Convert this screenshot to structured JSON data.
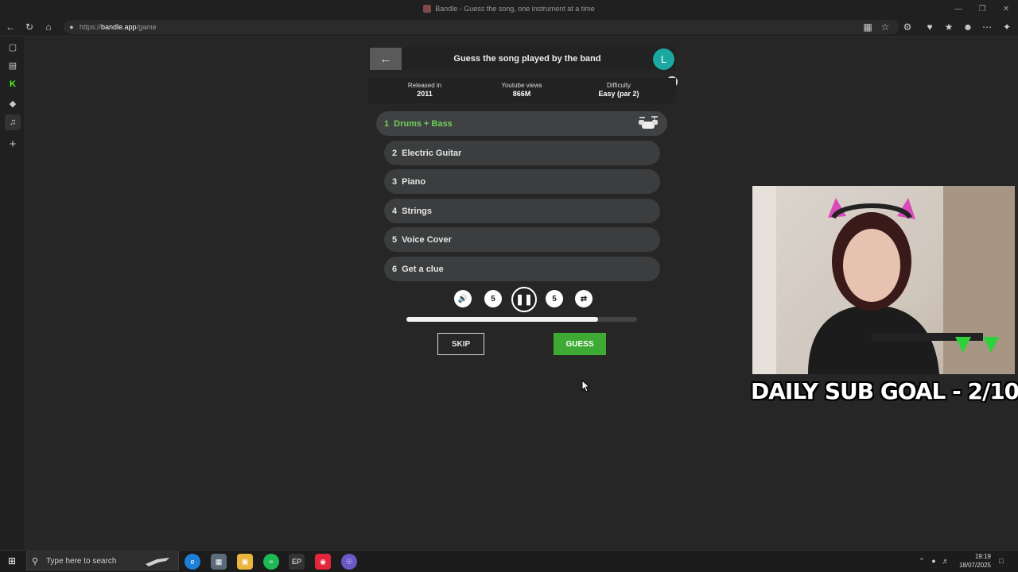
{
  "window": {
    "title": "Bandle - Guess the song, one instrument at a time"
  },
  "browser": {
    "url_prefix": "https://",
    "url_host": "bandle.app",
    "url_path": "/game"
  },
  "game": {
    "title": "Guess the song played by the band",
    "avatar_letter": "L",
    "stats": [
      {
        "label": "Released in",
        "value": "2011"
      },
      {
        "label": "Youtube views",
        "value": "866M"
      },
      {
        "label": "Difficulty",
        "value": "Easy (par 2)"
      }
    ],
    "clues": [
      {
        "num": "1",
        "label": "Drums + Bass",
        "active": true
      },
      {
        "num": "2",
        "label": "Electric Guitar",
        "active": false
      },
      {
        "num": "3",
        "label": "Piano",
        "active": false
      },
      {
        "num": "4",
        "label": "Strings",
        "active": false
      },
      {
        "num": "5",
        "label": "Voice Cover",
        "active": false
      },
      {
        "num": "6",
        "label": "Get a clue",
        "active": false
      }
    ],
    "controls": {
      "rewind_seconds": "5",
      "forward_seconds": "5"
    },
    "progress": 0.83,
    "skip_label": "SKIP",
    "guess_label": "GUESS",
    "active_color": "#6fd25a",
    "guess_color": "#3eaa33"
  },
  "overlay": {
    "sub_goal": "DAILY SUB GOAL - 2/10"
  },
  "taskbar": {
    "search_placeholder": "Type here to search",
    "time": "19:19",
    "date": "18/07/2025"
  }
}
